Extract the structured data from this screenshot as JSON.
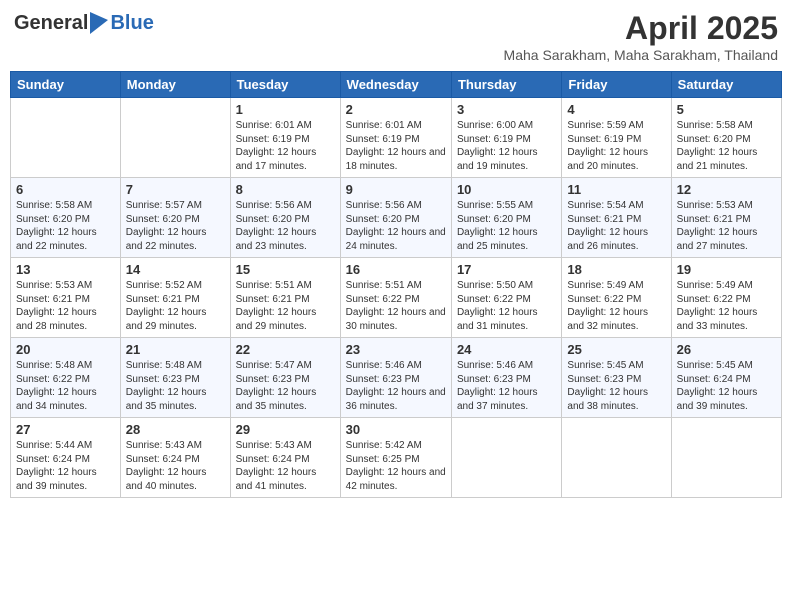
{
  "logo": {
    "text_general": "General",
    "text_blue": "Blue"
  },
  "title": "April 2025",
  "location": "Maha Sarakham, Maha Sarakham, Thailand",
  "days_of_week": [
    "Sunday",
    "Monday",
    "Tuesday",
    "Wednesday",
    "Thursday",
    "Friday",
    "Saturday"
  ],
  "weeks": [
    [
      {
        "day": "",
        "sunrise": "",
        "sunset": "",
        "daylight": ""
      },
      {
        "day": "",
        "sunrise": "",
        "sunset": "",
        "daylight": ""
      },
      {
        "day": "1",
        "sunrise": "Sunrise: 6:01 AM",
        "sunset": "Sunset: 6:19 PM",
        "daylight": "Daylight: 12 hours and 17 minutes."
      },
      {
        "day": "2",
        "sunrise": "Sunrise: 6:01 AM",
        "sunset": "Sunset: 6:19 PM",
        "daylight": "Daylight: 12 hours and 18 minutes."
      },
      {
        "day": "3",
        "sunrise": "Sunrise: 6:00 AM",
        "sunset": "Sunset: 6:19 PM",
        "daylight": "Daylight: 12 hours and 19 minutes."
      },
      {
        "day": "4",
        "sunrise": "Sunrise: 5:59 AM",
        "sunset": "Sunset: 6:19 PM",
        "daylight": "Daylight: 12 hours and 20 minutes."
      },
      {
        "day": "5",
        "sunrise": "Sunrise: 5:58 AM",
        "sunset": "Sunset: 6:20 PM",
        "daylight": "Daylight: 12 hours and 21 minutes."
      }
    ],
    [
      {
        "day": "6",
        "sunrise": "Sunrise: 5:58 AM",
        "sunset": "Sunset: 6:20 PM",
        "daylight": "Daylight: 12 hours and 22 minutes."
      },
      {
        "day": "7",
        "sunrise": "Sunrise: 5:57 AM",
        "sunset": "Sunset: 6:20 PM",
        "daylight": "Daylight: 12 hours and 22 minutes."
      },
      {
        "day": "8",
        "sunrise": "Sunrise: 5:56 AM",
        "sunset": "Sunset: 6:20 PM",
        "daylight": "Daylight: 12 hours and 23 minutes."
      },
      {
        "day": "9",
        "sunrise": "Sunrise: 5:56 AM",
        "sunset": "Sunset: 6:20 PM",
        "daylight": "Daylight: 12 hours and 24 minutes."
      },
      {
        "day": "10",
        "sunrise": "Sunrise: 5:55 AM",
        "sunset": "Sunset: 6:20 PM",
        "daylight": "Daylight: 12 hours and 25 minutes."
      },
      {
        "day": "11",
        "sunrise": "Sunrise: 5:54 AM",
        "sunset": "Sunset: 6:21 PM",
        "daylight": "Daylight: 12 hours and 26 minutes."
      },
      {
        "day": "12",
        "sunrise": "Sunrise: 5:53 AM",
        "sunset": "Sunset: 6:21 PM",
        "daylight": "Daylight: 12 hours and 27 minutes."
      }
    ],
    [
      {
        "day": "13",
        "sunrise": "Sunrise: 5:53 AM",
        "sunset": "Sunset: 6:21 PM",
        "daylight": "Daylight: 12 hours and 28 minutes."
      },
      {
        "day": "14",
        "sunrise": "Sunrise: 5:52 AM",
        "sunset": "Sunset: 6:21 PM",
        "daylight": "Daylight: 12 hours and 29 minutes."
      },
      {
        "day": "15",
        "sunrise": "Sunrise: 5:51 AM",
        "sunset": "Sunset: 6:21 PM",
        "daylight": "Daylight: 12 hours and 29 minutes."
      },
      {
        "day": "16",
        "sunrise": "Sunrise: 5:51 AM",
        "sunset": "Sunset: 6:22 PM",
        "daylight": "Daylight: 12 hours and 30 minutes."
      },
      {
        "day": "17",
        "sunrise": "Sunrise: 5:50 AM",
        "sunset": "Sunset: 6:22 PM",
        "daylight": "Daylight: 12 hours and 31 minutes."
      },
      {
        "day": "18",
        "sunrise": "Sunrise: 5:49 AM",
        "sunset": "Sunset: 6:22 PM",
        "daylight": "Daylight: 12 hours and 32 minutes."
      },
      {
        "day": "19",
        "sunrise": "Sunrise: 5:49 AM",
        "sunset": "Sunset: 6:22 PM",
        "daylight": "Daylight: 12 hours and 33 minutes."
      }
    ],
    [
      {
        "day": "20",
        "sunrise": "Sunrise: 5:48 AM",
        "sunset": "Sunset: 6:22 PM",
        "daylight": "Daylight: 12 hours and 34 minutes."
      },
      {
        "day": "21",
        "sunrise": "Sunrise: 5:48 AM",
        "sunset": "Sunset: 6:23 PM",
        "daylight": "Daylight: 12 hours and 35 minutes."
      },
      {
        "day": "22",
        "sunrise": "Sunrise: 5:47 AM",
        "sunset": "Sunset: 6:23 PM",
        "daylight": "Daylight: 12 hours and 35 minutes."
      },
      {
        "day": "23",
        "sunrise": "Sunrise: 5:46 AM",
        "sunset": "Sunset: 6:23 PM",
        "daylight": "Daylight: 12 hours and 36 minutes."
      },
      {
        "day": "24",
        "sunrise": "Sunrise: 5:46 AM",
        "sunset": "Sunset: 6:23 PM",
        "daylight": "Daylight: 12 hours and 37 minutes."
      },
      {
        "day": "25",
        "sunrise": "Sunrise: 5:45 AM",
        "sunset": "Sunset: 6:23 PM",
        "daylight": "Daylight: 12 hours and 38 minutes."
      },
      {
        "day": "26",
        "sunrise": "Sunrise: 5:45 AM",
        "sunset": "Sunset: 6:24 PM",
        "daylight": "Daylight: 12 hours and 39 minutes."
      }
    ],
    [
      {
        "day": "27",
        "sunrise": "Sunrise: 5:44 AM",
        "sunset": "Sunset: 6:24 PM",
        "daylight": "Daylight: 12 hours and 39 minutes."
      },
      {
        "day": "28",
        "sunrise": "Sunrise: 5:43 AM",
        "sunset": "Sunset: 6:24 PM",
        "daylight": "Daylight: 12 hours and 40 minutes."
      },
      {
        "day": "29",
        "sunrise": "Sunrise: 5:43 AM",
        "sunset": "Sunset: 6:24 PM",
        "daylight": "Daylight: 12 hours and 41 minutes."
      },
      {
        "day": "30",
        "sunrise": "Sunrise: 5:42 AM",
        "sunset": "Sunset: 6:25 PM",
        "daylight": "Daylight: 12 hours and 42 minutes."
      },
      {
        "day": "",
        "sunrise": "",
        "sunset": "",
        "daylight": ""
      },
      {
        "day": "",
        "sunrise": "",
        "sunset": "",
        "daylight": ""
      },
      {
        "day": "",
        "sunrise": "",
        "sunset": "",
        "daylight": ""
      }
    ]
  ]
}
